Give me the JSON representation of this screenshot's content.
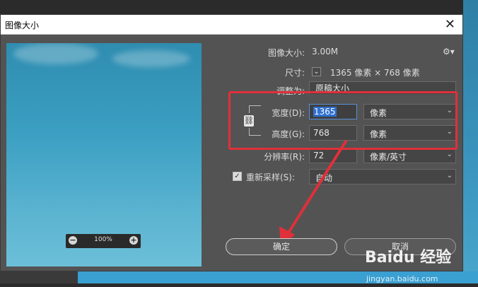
{
  "dialog": {
    "title": "图像大小",
    "close_label": "✕"
  },
  "preview": {
    "zoom_level": "100%"
  },
  "info": {
    "image_size_label": "图像大小:",
    "image_size_value": "3.00M",
    "dimensions_label": "尺寸:",
    "dimensions_value": "1365 像素 × 768 像素",
    "fit_label": "调整为:",
    "fit_value": "原稿大小"
  },
  "width": {
    "label": "宽度(D):",
    "value": "1365",
    "unit": "像素"
  },
  "height": {
    "label": "高度(G):",
    "value": "768",
    "unit": "像素"
  },
  "resolution": {
    "label": "分辨率(R):",
    "value": "72",
    "unit": "像素/英寸"
  },
  "resample": {
    "label": "重新采样(S):",
    "value": "自动",
    "checked": true
  },
  "buttons": {
    "ok": "确定",
    "cancel": "取消"
  },
  "watermark": {
    "main": "Baidu 经验",
    "sub": "jingyan.baidu.com"
  },
  "colors": {
    "annotation_red": "#e0303a",
    "dialog_bg": "#535353"
  }
}
